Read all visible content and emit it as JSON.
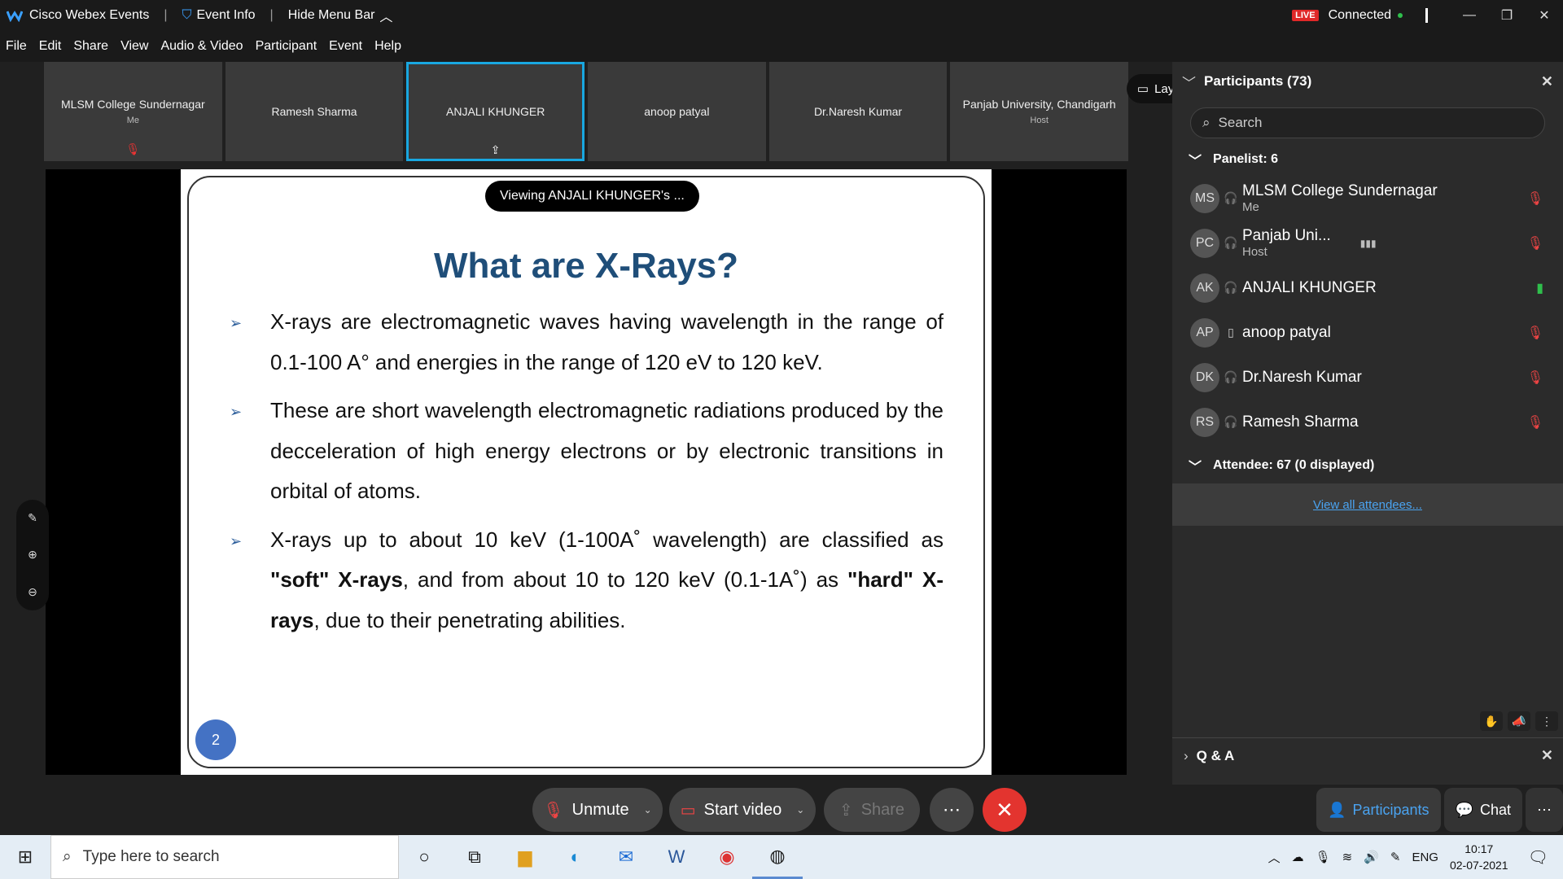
{
  "titlebar": {
    "app_name": "Cisco Webex Events",
    "event_info": "Event Info",
    "hide_menu": "Hide Menu Bar",
    "live_badge": "LIVE",
    "connection": "Connected"
  },
  "menu": [
    "File",
    "Edit",
    "Share",
    "View",
    "Audio & Video",
    "Participant",
    "Event",
    "Help"
  ],
  "video_strip": [
    {
      "name": "MLSM College Sundernagar",
      "sub": "Me"
    },
    {
      "name": "Ramesh Sharma",
      "sub": ""
    },
    {
      "name": "ANJALI KHUNGER",
      "sub": ""
    },
    {
      "name": "anoop patyal",
      "sub": ""
    },
    {
      "name": "Dr.Naresh Kumar",
      "sub": ""
    },
    {
      "name": "Panjab University, Chandigarh",
      "sub": "Host"
    }
  ],
  "layout_button": "Layout",
  "viewing_label": "Viewing ANJALI KHUNGER's ...",
  "slide": {
    "title": "What are X-Rays?",
    "bullet1": "X-rays are electromagnetic waves having wavelength in the range of 0.1-100 A° and energies in the range of 120 eV to 120 keV.",
    "bullet2": "These are short wavelength electromagnetic radiations produced by the decceleration of high energy electrons or by electronic transitions in orbital of atoms.",
    "bullet3_a": " X-rays up to about 10 keV (1-100A˚ wavelength) are classified as ",
    "bullet3_soft": "\"soft\" X-rays",
    "bullet3_b": ", and from about 10 to 120 keV (0.1-1A˚) as ",
    "bullet3_hard": "\"hard\" X-rays",
    "bullet3_c": ", due to their penetrating abilities.",
    "page_number": "2"
  },
  "panel": {
    "title": "Participants (73)",
    "search_placeholder": "Search",
    "panelist_group": "Panelist: 6",
    "panelists": [
      {
        "initials": "MS",
        "name": "MLSM College Sundernagar",
        "role": "Me"
      },
      {
        "initials": "PC",
        "name": "Panjab Uni...",
        "role": "Host"
      },
      {
        "initials": "AK",
        "name": "ANJALI KHUNGER",
        "role": ""
      },
      {
        "initials": "AP",
        "name": "anoop patyal",
        "role": ""
      },
      {
        "initials": "DK",
        "name": "Dr.Naresh Kumar",
        "role": ""
      },
      {
        "initials": "RS",
        "name": "Ramesh Sharma",
        "role": ""
      }
    ],
    "attendee_group": "Attendee: 67 (0 displayed)",
    "view_all": "View all attendees...",
    "qa_label": "Q & A"
  },
  "controls": {
    "unmute": "Unmute",
    "start_video": "Start video",
    "share": "Share",
    "participants_tab": "Participants",
    "chat_tab": "Chat"
  },
  "taskbar": {
    "search_placeholder": "Type here to search",
    "lang": "ENG",
    "time": "10:17",
    "date": "02-07-2021"
  },
  "colors": {
    "accent": "#19a7e0",
    "end_call": "#e3342f",
    "slide_title": "#1f4e79",
    "link": "#4aa3f0"
  }
}
